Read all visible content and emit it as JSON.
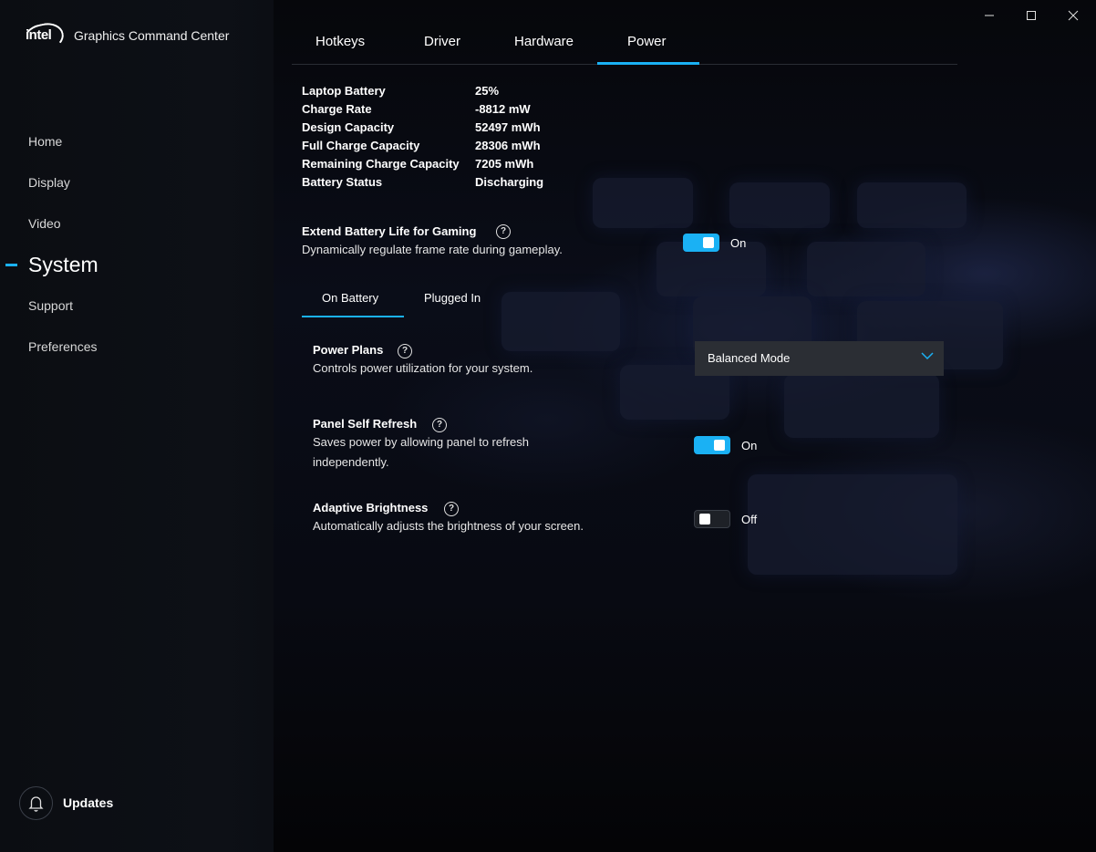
{
  "app": {
    "logo": "intel",
    "title": "Graphics Command Center"
  },
  "sidebar": {
    "items": [
      {
        "label": "Home"
      },
      {
        "label": "Display"
      },
      {
        "label": "Video"
      },
      {
        "label": "System",
        "active": true
      },
      {
        "label": "Support"
      },
      {
        "label": "Preferences"
      }
    ],
    "updates_label": "Updates",
    "updates_icon": "bell-icon"
  },
  "window_controls": [
    "minimize-icon",
    "maximize-icon",
    "close-icon"
  ],
  "tabs": [
    {
      "label": "Hotkeys"
    },
    {
      "label": "Driver"
    },
    {
      "label": "Hardware"
    },
    {
      "label": "Power",
      "active": true
    }
  ],
  "battery_info": [
    {
      "label": "Laptop Battery",
      "value": "25%"
    },
    {
      "label": "Charge Rate",
      "value": "-8812 mW"
    },
    {
      "label": "Design Capacity",
      "value": "52497 mWh"
    },
    {
      "label": "Full Charge Capacity",
      "value": "28306 mWh"
    },
    {
      "label": "Remaining Charge Capacity",
      "value": "7205 mWh"
    },
    {
      "label": "Battery Status",
      "value": "Discharging"
    }
  ],
  "extend_battery": {
    "title": "Extend Battery Life for Gaming",
    "description": "Dynamically regulate frame rate during gameplay.",
    "state": "On"
  },
  "subtabs": [
    {
      "label": "On Battery",
      "active": true
    },
    {
      "label": "Plugged In"
    }
  ],
  "power_plans": {
    "title": "Power Plans",
    "description": "Controls power utilization for your system.",
    "selected": "Balanced Mode"
  },
  "panel_self_refresh": {
    "title": "Panel Self Refresh",
    "description_line1": "Saves power by allowing panel to refresh",
    "description_line2": "independently.",
    "state": "On"
  },
  "adaptive_brightness": {
    "title": "Adaptive Brightness",
    "description": "Automatically adjusts the brightness of your screen.",
    "state": "Off"
  },
  "colors": {
    "accent": "#1ab1f4",
    "background": "#050608",
    "sidebar": "#0d1016",
    "dropdown": "#2b2e34"
  }
}
